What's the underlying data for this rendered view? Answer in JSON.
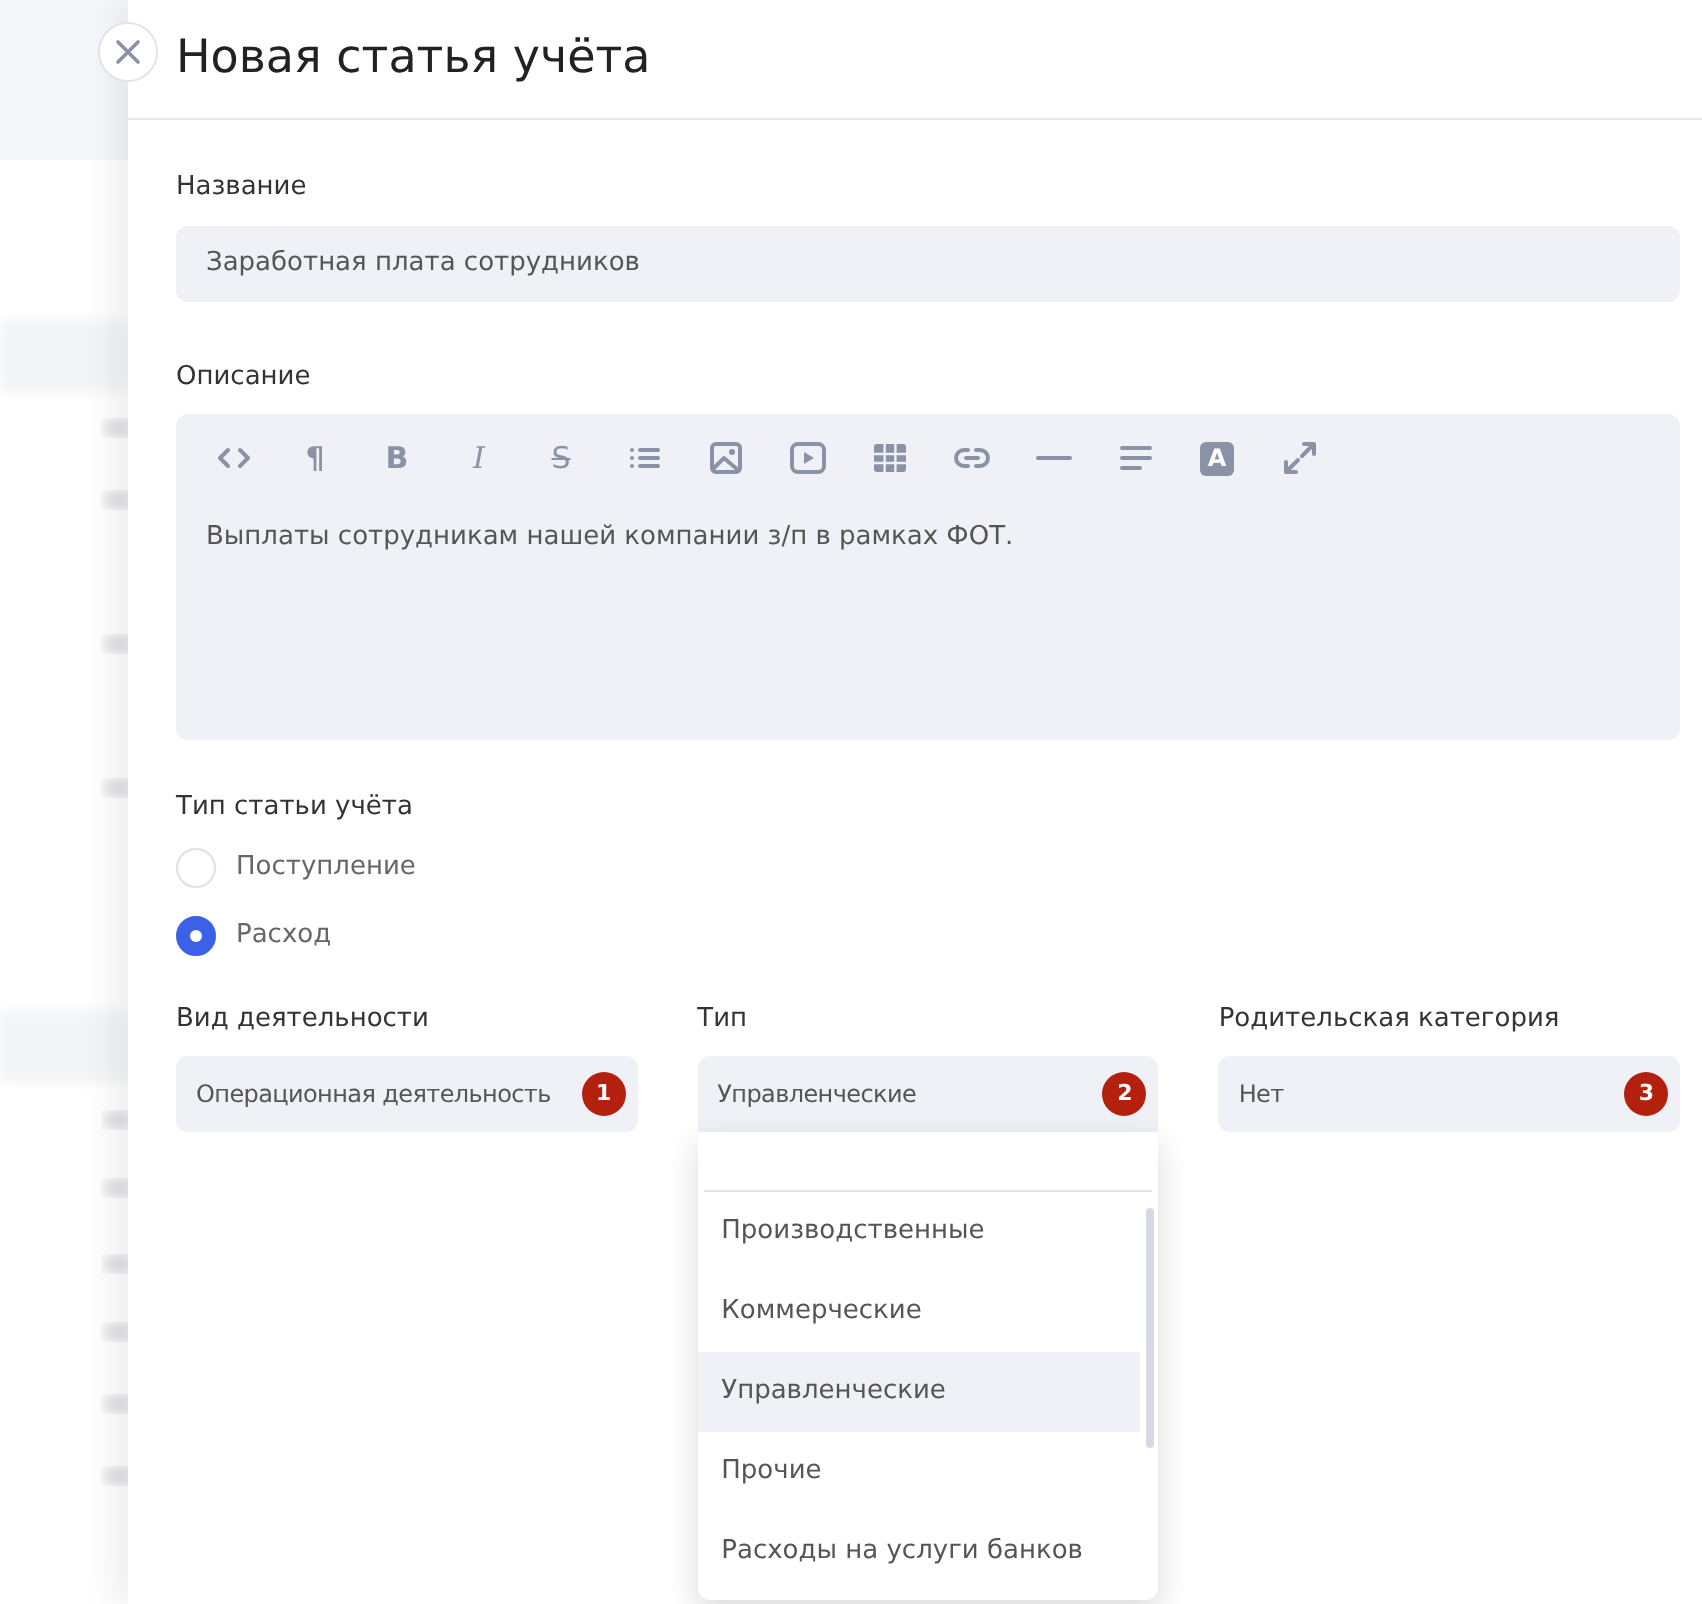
{
  "title": "Новая статья учёта",
  "name_field": {
    "label": "Название",
    "value": "Заработная плата сотрудников"
  },
  "description": {
    "label": "Описание",
    "toolbar": [
      {
        "kind": "code"
      },
      {
        "kind": "paragraph",
        "glyph": "¶"
      },
      {
        "kind": "bold",
        "glyph": "B"
      },
      {
        "kind": "italic",
        "glyph": "I"
      },
      {
        "kind": "strike",
        "glyph": "S"
      },
      {
        "kind": "list"
      },
      {
        "kind": "image"
      },
      {
        "kind": "video"
      },
      {
        "kind": "table"
      },
      {
        "kind": "link"
      },
      {
        "kind": "rule"
      },
      {
        "kind": "align"
      },
      {
        "kind": "color",
        "glyph": "A"
      },
      {
        "kind": "fullscreen"
      }
    ],
    "value": "Выплаты сотрудникам нашей компании з/п в рамках ФОТ."
  },
  "account_type": {
    "label": "Тип статьи учёта",
    "options": [
      {
        "label": "Поступление",
        "selected": false
      },
      {
        "label": "Расход",
        "selected": true
      }
    ]
  },
  "selects": [
    {
      "label": "Вид деятельности",
      "value": "Операционная деятельность",
      "badge": "1",
      "expanded": false
    },
    {
      "label": "Тип",
      "value": "Управленческие",
      "badge": "2",
      "expanded": true
    },
    {
      "label": "Родительская категория",
      "value": "Нет",
      "badge": "3",
      "expanded": false
    }
  ],
  "dropdown": {
    "options": [
      {
        "label": "Производственные",
        "selected": false
      },
      {
        "label": "Коммерческие",
        "selected": false
      },
      {
        "label": "Управленческие",
        "selected": true
      },
      {
        "label": "Прочие",
        "selected": false
      },
      {
        "label": "Расходы на услуги банков",
        "selected": false
      }
    ]
  }
}
